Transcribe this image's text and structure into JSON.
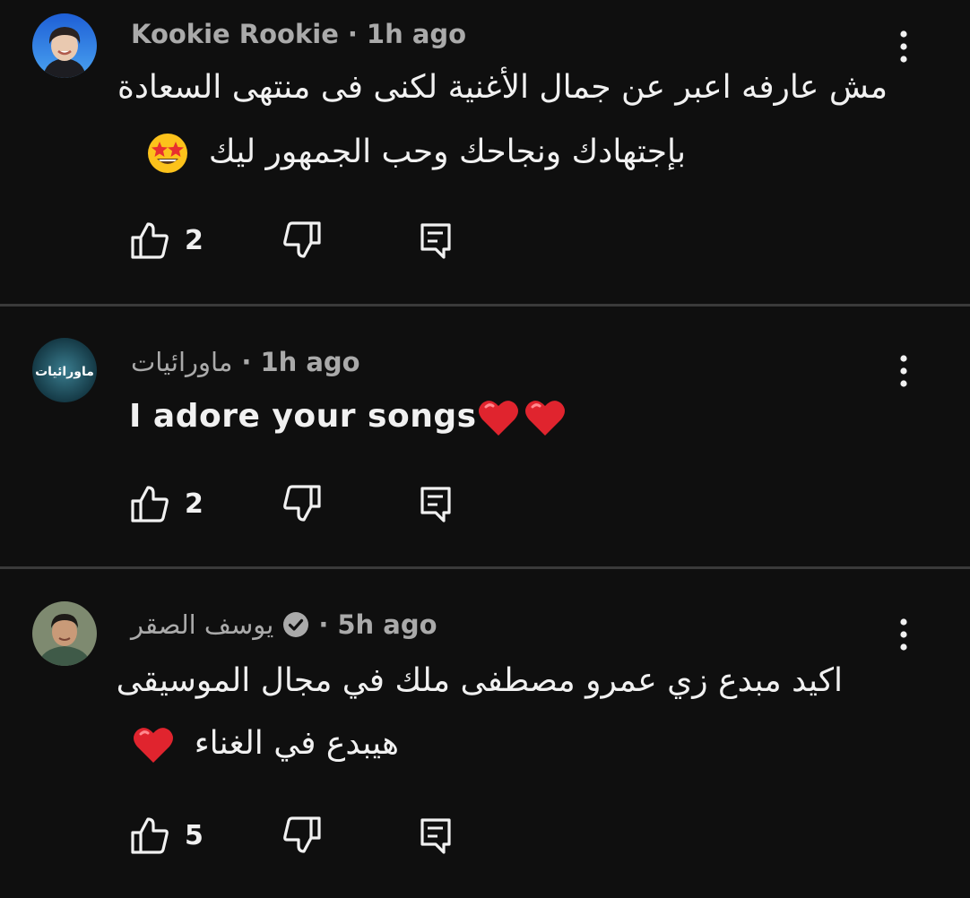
{
  "comments": [
    {
      "author": "Kookie Rookie",
      "separator": "·",
      "time": "1h ago",
      "verified": false,
      "lines": [
        "مش عارفه اعبر عن جمال الأغنية لكنى فى منتهى السعادة",
        "بإجتهادك ونجاحك وحب الجمهور ليك"
      ],
      "emoji": "star-struck-emoji",
      "likes": "2",
      "avatar_icon": "profile-photo"
    },
    {
      "author": "ماورائيات",
      "avatar_text": "ماورائيات",
      "separator": "·",
      "time": "1h ago",
      "verified": false,
      "lines": [
        "I adore your songs"
      ],
      "emoji": "red-heart-emoji x2",
      "likes": "2",
      "avatar_icon": "channel-logo"
    },
    {
      "author": "يوسف الصقر",
      "separator": "·",
      "time": "5h ago",
      "verified": true,
      "lines": [
        "اكيد مبدع زي عمرو مصطفى ملك في مجال الموسيقى",
        "هيبدع في الغناء"
      ],
      "emoji": "red-heart-emoji",
      "likes": "5",
      "avatar_icon": "profile-photo"
    }
  ],
  "icons": {
    "like": "thumb-up-icon",
    "dislike": "thumb-down-icon",
    "reply": "reply-icon",
    "more": "more-vert-icon",
    "verified": "verified-check-icon"
  },
  "colors": {
    "background": "#0f0f0f",
    "text": "#f1f1f1",
    "secondary_text": "#aaaaaa",
    "divider": "#3a3a3a",
    "heart": "#e0242e"
  }
}
